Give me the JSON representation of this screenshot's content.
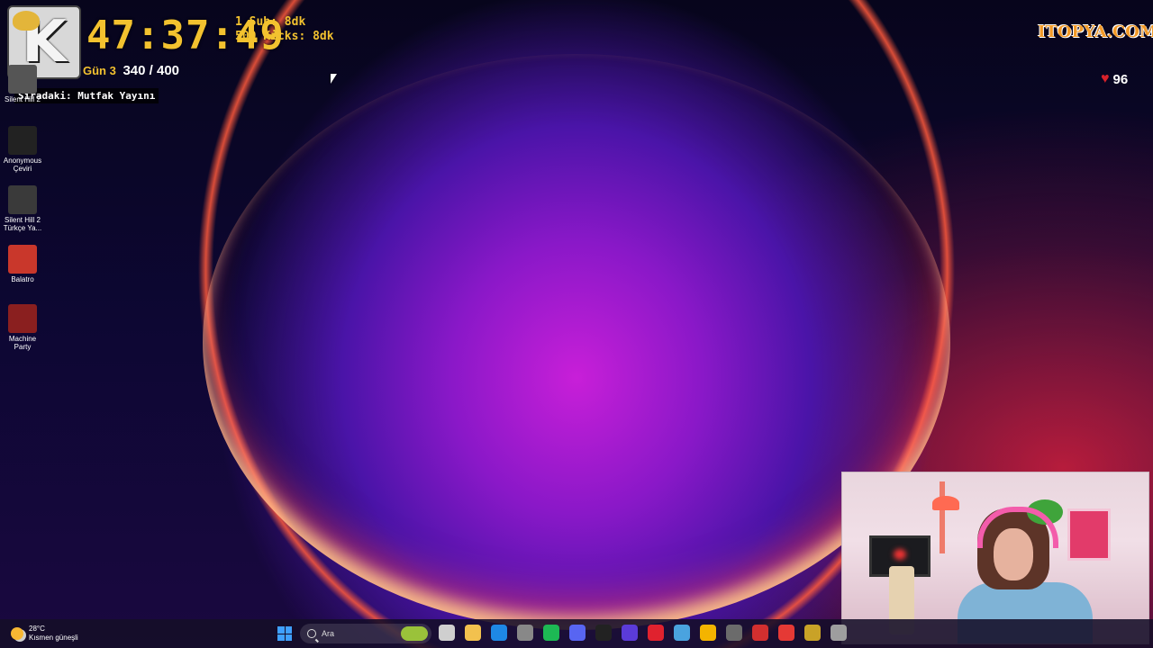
{
  "overlay": {
    "logo_letter": "K",
    "timer": "47:37:49",
    "day_label": "Gün 3",
    "sub_count": "340 / 400",
    "goal_1": "1 Sub: 8dk",
    "goal_2": "500 Kicks: 8dk",
    "next_stream": "Sıradaki: Mutfak Yayını",
    "brand": "ITOPYA.COM",
    "hearts_count": "96"
  },
  "desktop_icons": [
    {
      "label": "Silent Hill 2",
      "icon": "silent-hill-icon",
      "color": "#555555"
    },
    {
      "label": "Anonymous Çeviri",
      "icon": "anonymous-icon",
      "color": "#222222"
    },
    {
      "label": "Silent Hill 2 Türkçe Ya...",
      "icon": "silent-hill-tr-icon",
      "color": "#3a3a3a"
    },
    {
      "label": "Balatro",
      "icon": "balatro-icon",
      "color": "#c9372b"
    },
    {
      "label": "Machine Party",
      "icon": "machine-party-icon",
      "color": "#8a1f1f"
    }
  ],
  "taskbar": {
    "temperature": "28°C",
    "weather": "Kısmen güneşli",
    "search_placeholder": "Ara",
    "apps": [
      {
        "icon": "task-view-icon",
        "color": "#cfcfcf"
      },
      {
        "icon": "file-explorer-icon",
        "color": "#f2c14e"
      },
      {
        "icon": "outlook-icon",
        "color": "#1e88e5"
      },
      {
        "icon": "chatgpt-icon",
        "color": "#888888"
      },
      {
        "icon": "spotify-icon",
        "color": "#1db954"
      },
      {
        "icon": "discord-icon",
        "color": "#5865f2"
      },
      {
        "icon": "logitech-icon",
        "color": "#222222"
      },
      {
        "icon": "app-grid-icon",
        "color": "#5b3bd8"
      },
      {
        "icon": "opera-icon",
        "color": "#e0222e"
      },
      {
        "icon": "notepad-icon",
        "color": "#4aa3df"
      },
      {
        "icon": "chrome-icon",
        "color": "#f4b400"
      },
      {
        "icon": "game-icon",
        "color": "#6b6b6b"
      },
      {
        "icon": "media-icon",
        "color": "#d32f2f"
      },
      {
        "icon": "red-app-icon",
        "color": "#e53935"
      },
      {
        "icon": "brush-icon",
        "color": "#c9a227"
      },
      {
        "icon": "settings-icon",
        "color": "#9e9e9e"
      }
    ]
  }
}
